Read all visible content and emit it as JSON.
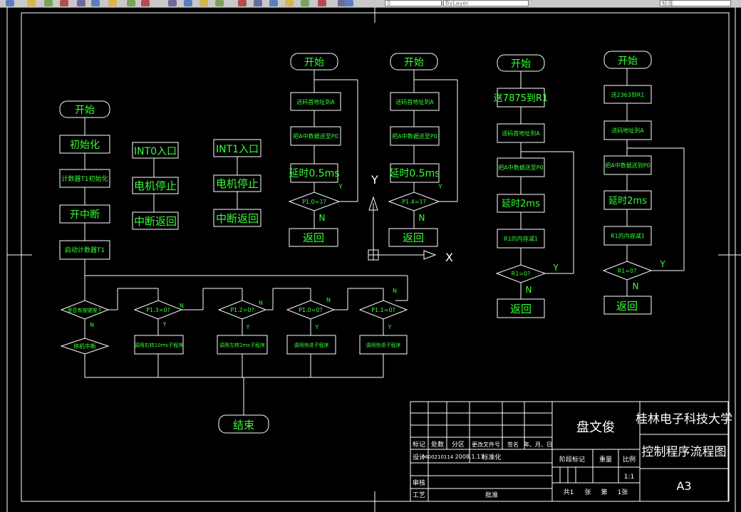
{
  "toolbar": {
    "icons": [
      "open-icon",
      "print-icon",
      "preview-icon",
      "publish-icon",
      "cut-icon",
      "copy-icon",
      "paste-icon",
      "match-icon",
      "undo-icon",
      "redo-icon",
      "pan-icon",
      "zoom-realtime-icon",
      "zoom-window-icon",
      "zoom-previous-icon",
      "properties-icon",
      "design-center-icon",
      "tool-palette-icon",
      "sheet-set-icon",
      "markup-icon",
      "calc-icon",
      "help-icon"
    ],
    "layer_combo_value": "0",
    "linetype_combo_value": "ByLayer",
    "text_style_value": "标准"
  },
  "chart_data": {
    "type": "flowchart",
    "colors": {
      "background": "#000000",
      "flow": "#33ff33",
      "frame": "#ffffff"
    },
    "main_flow": {
      "start": "开始",
      "steps": [
        "初始化",
        "计数器T1初始化",
        "开中断",
        "启动计数器T1"
      ],
      "decisions": [
        "是否有按键按下",
        "P1.3=0?",
        "P1.2=0?",
        "P1.0=0?",
        "P1.1=0?"
      ],
      "branch_labels": [
        "N",
        "Y"
      ],
      "actions": [
        "停机中断",
        "调用右转10ms子程序",
        "调用左转2ms子程序",
        "调用快进子程序",
        "调用快退子程序"
      ],
      "end": "结束"
    },
    "int0": {
      "steps": [
        "INT0入口",
        "电机停止",
        "中断返回"
      ]
    },
    "int1": {
      "steps": [
        "INT1入口",
        "电机停止",
        "中断返回"
      ]
    },
    "sub1": {
      "start": "开始",
      "steps": [
        "送码首地址到A",
        "把A中数据送至P0",
        "延时0.5ms"
      ],
      "decision": "P1.0=1?",
      "yes": "Y",
      "no": "N",
      "end": "返回"
    },
    "sub2": {
      "start": "开始",
      "steps": [
        "送码首地址到A",
        "把A中数据送至P0",
        "延时0.5ms"
      ],
      "decision": "P1.4=1?",
      "yes": "Y",
      "no": "N",
      "end": "返回"
    },
    "sub3": {
      "start": "开始",
      "steps": [
        "送7875到R1",
        "送码首地址到A",
        "把A中数据送至P0",
        "延时2ms",
        "R1的内容减1"
      ],
      "decision": "R1=0?",
      "yes": "Y",
      "no": "N",
      "end": "返回"
    },
    "sub4": {
      "start": "开始",
      "steps": [
        "送2363到R1",
        "送码地址到A",
        "把A中数据送到P0",
        "延时2ms",
        "R1的内容减1"
      ],
      "decision": "R1=0?",
      "yes": "Y",
      "no": "N",
      "end": "返回"
    },
    "ucs": {
      "x": "X",
      "y": "Y"
    }
  },
  "title_block": {
    "author": "盘文俊",
    "school": "桂林电子科技大学",
    "drawing_title": "控制程序流程图",
    "sheet_size": "A3",
    "headers": [
      "标记",
      "处数",
      "分区",
      "更改文件号",
      "签名",
      "年、月、日"
    ],
    "design_label": "设计",
    "student_id": "0400210114",
    "date": "2008.1.11",
    "standardize_label": "标准化",
    "review_label": "审核",
    "process_label": "工艺",
    "approve_label": "批准",
    "stage_label": "阶段标记",
    "weight_label": "重量",
    "scale_label": "比例",
    "scale_value": "1:1",
    "sheets_total": "共1",
    "sheet_word": "张",
    "sheet_no": "第",
    "sheet_one": "1张"
  }
}
